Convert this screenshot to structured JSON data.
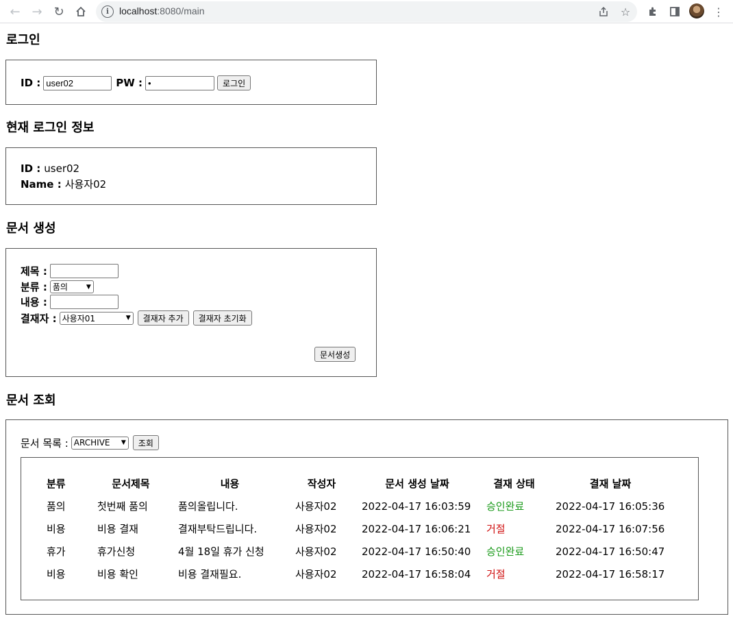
{
  "browser": {
    "url_host": "localhost",
    "url_path": ":8080/main"
  },
  "login": {
    "heading": "로그인",
    "id_label": "ID :",
    "id_value": "user02",
    "pw_label": "PW :",
    "pw_value": "•",
    "login_button": "로그인"
  },
  "current": {
    "heading": "현재 로그인 정보",
    "id_label": "ID :",
    "id_value": "user02",
    "name_label": "Name :",
    "name_value": "사용자02"
  },
  "create": {
    "heading": "문서 생성",
    "title_label": "제목 :",
    "title_value": "",
    "category_label": "분류 :",
    "category_selected": "품의",
    "content_label": "내용 :",
    "content_value": "",
    "approver_label": "결재자 :",
    "approver_selected": "사용자01",
    "add_approver_button": "결재자 추가",
    "reset_approver_button": "결재자 초기화",
    "create_button": "문서생성"
  },
  "query": {
    "heading": "문서 조회",
    "list_label": "문서 목록 :",
    "list_selected": "ARCHIVE",
    "query_button": "조회",
    "columns": [
      "분류",
      "문서제목",
      "내용",
      "작성자",
      "문서 생성 날짜",
      "결재 상태",
      "결재 날짜"
    ],
    "rows": [
      [
        "품의",
        "첫번째 품의",
        "품의올립니다.",
        "사용자02",
        "2022-04-17 16:03:59",
        "승인완료",
        "2022-04-17 16:05:36"
      ],
      [
        "비용",
        "비용 결재",
        "결재부탁드립니다.",
        "사용자02",
        "2022-04-17 16:06:21",
        "거절",
        "2022-04-17 16:07:56"
      ],
      [
        "휴가",
        "휴가신청",
        "4월 18일 휴가 신청",
        "사용자02",
        "2022-04-17 16:50:40",
        "승인완료",
        "2022-04-17 16:50:47"
      ],
      [
        "비용",
        "비용 확인",
        "비용 결재필요.",
        "사용자02",
        "2022-04-17 16:58:04",
        "거절",
        "2022-04-17 16:58:17"
      ]
    ]
  },
  "colors": {
    "approved": "#1a9a1a",
    "rejected": "#d01010"
  }
}
